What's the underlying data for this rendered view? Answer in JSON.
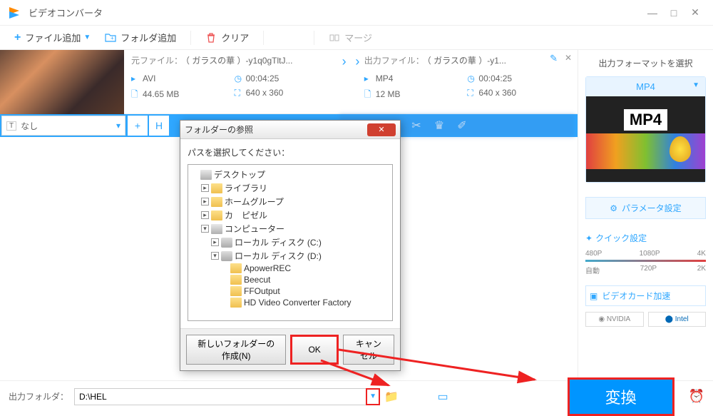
{
  "window": {
    "title": "ビデオコンバータ"
  },
  "toolbar": {
    "add_file": "ファイル追加",
    "add_folder": "フォルダ追加",
    "clear": "クリア",
    "merge": "マージ"
  },
  "file": {
    "src_label": "元ファイル：",
    "src_name": "（ ガラスの華 ）-y1q0gTltJ...",
    "src_format": "AVI",
    "src_duration": "00:04:25",
    "src_size": "44.65 MB",
    "src_res": "640 x 360",
    "out_label": "出力ファイル：",
    "out_name": "（ ガラスの華 ）-y1...",
    "out_format": "MP4",
    "out_duration": "00:04:25",
    "out_size": "12 MB",
    "out_res": "640 x 360",
    "subtitle_none": "なし"
  },
  "sidebar": {
    "format_title": "出力フォーマットを選択",
    "format": "MP4",
    "param_btn": "パラメータ設定",
    "quickset": "クイック設定",
    "res_top": [
      "480P",
      "1080P",
      "4K"
    ],
    "res_bottom": [
      "自動",
      "720P",
      "2K"
    ],
    "hwaccel": "ビデオカード加速",
    "gpu1": "NVIDIA",
    "gpu2": "Intel"
  },
  "bottom": {
    "out_folder_label": "出力フォルダ：",
    "out_folder": "D:\\HEL",
    "convert": "変換"
  },
  "dialog": {
    "title": "フォルダーの参照",
    "prompt": "パスを選択してください：",
    "nodes": {
      "desktop": "デスクトップ",
      "libraries": "ライブラリ",
      "homegroup": "ホームグループ",
      "user": "カ　ピゼル",
      "computer": "コンピューター",
      "drive_c": "ローカル ディスク (C:)",
      "drive_d": "ローカル ディスク (D:)",
      "f1": "ApowerREC",
      "f2": "Beecut",
      "f3": "FFOutput",
      "f4": "HD Video Converter Factory"
    },
    "new_folder": "新しいフォルダーの作成(N)",
    "ok": "OK",
    "cancel": "キャンセル"
  }
}
